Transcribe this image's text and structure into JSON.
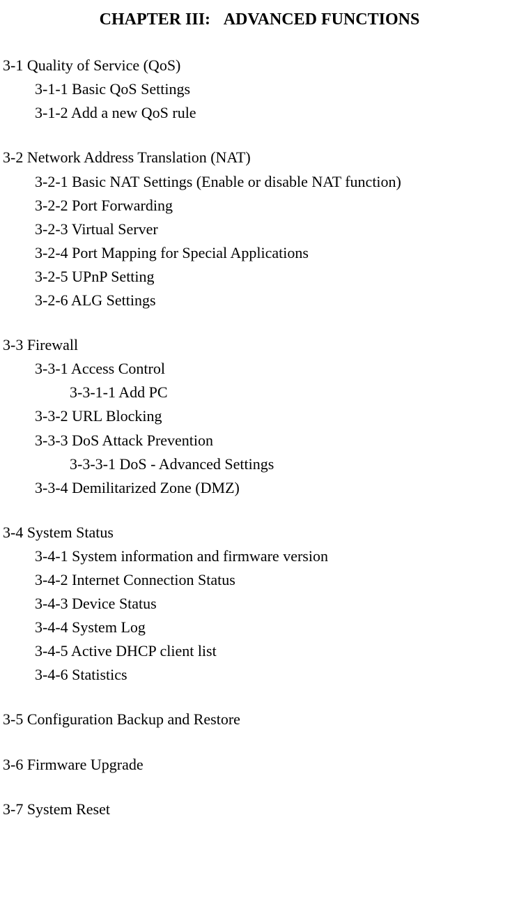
{
  "chapter": {
    "label_prefix": "CHAPTER III:",
    "label_title": "ADVANCED FUNCTIONS"
  },
  "s1": {
    "title": "3-1 Quality of Service (QoS)",
    "i1": "3-1-1 Basic QoS Settings",
    "i2": "3-1-2 Add a new QoS rule"
  },
  "s2": {
    "title": "3-2 Network Address Translation (NAT)",
    "i1": "3-2-1 Basic NAT Settings (Enable or disable NAT function)",
    "i2": "3-2-2 Port Forwarding",
    "i3": "3-2-3 Virtual Server",
    "i4": "3-2-4 Port Mapping for Special Applications",
    "i5": "3-2-5 UPnP Setting",
    "i6": "3-2-6 ALG Settings"
  },
  "s3": {
    "title": "3-3 Firewall",
    "i1": "3-3-1 Access Control",
    "i1a": "3-3-1-1 Add PC",
    "i2": "3-3-2 URL Blocking",
    "i3": "3-3-3 DoS Attack Prevention",
    "i3a": "3-3-3-1 DoS - Advanced Settings",
    "i4": "3-3-4 Demilitarized Zone (DMZ)"
  },
  "s4": {
    "title": "3-4 System Status",
    "i1": "3-4-1 System information and firmware version",
    "i2": "3-4-2 Internet Connection Status",
    "i3": "3-4-3 Device Status",
    "i4": "3-4-4 System Log",
    "i5": "3-4-5 Active DHCP client list",
    "i6": "3-4-6 Statistics"
  },
  "s5": {
    "title": "3-5 Configuration Backup and Restore"
  },
  "s6": {
    "title": "3-6 Firmware Upgrade"
  },
  "s7": {
    "title": "3-7 System Reset"
  }
}
